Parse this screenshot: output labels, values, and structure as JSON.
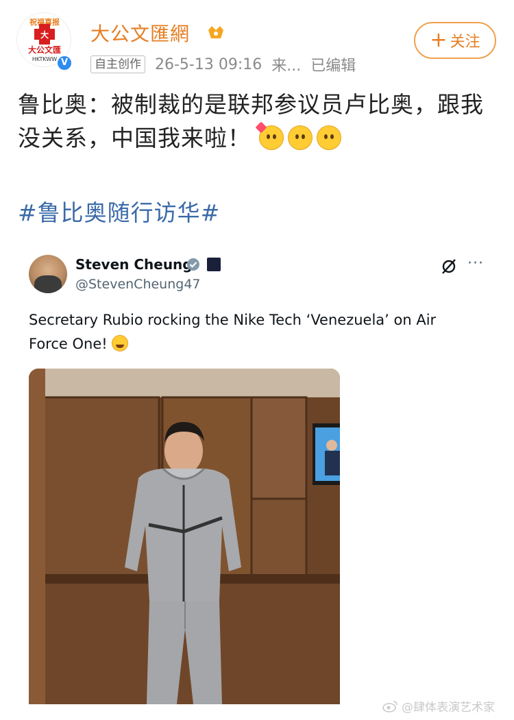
{
  "post": {
    "account_name": "大公文匯網",
    "avatar_logo_text": "大公文匯",
    "avatar_sub_text": "HKTKWW",
    "avatar_top_text": "祝福喜报",
    "verified_icon": "v-badge-icon",
    "tag": "自主创作",
    "time": "26-5-13 09:16",
    "source": "来...",
    "edited": "已编辑",
    "follow_label": "关注",
    "text_line": "鲁比奥：被制裁的是联邦参议员卢比奥，跟我没关系，中国我来啦！",
    "hashtag": "#鲁比奥随行访华#"
  },
  "tweet": {
    "name": "Steven Cheung",
    "handle": "@StevenCheung47",
    "text": "Secretary Rubio rocking the Nike Tech ‘Venezuela’ on Air Force One!",
    "more_icon": "···"
  },
  "watermark": {
    "text": "@肆体表演艺术家"
  },
  "colors": {
    "accent_orange": "#e67e22",
    "hashtag_blue": "#3a6aa8",
    "verified_blue": "#2e8cf0"
  }
}
